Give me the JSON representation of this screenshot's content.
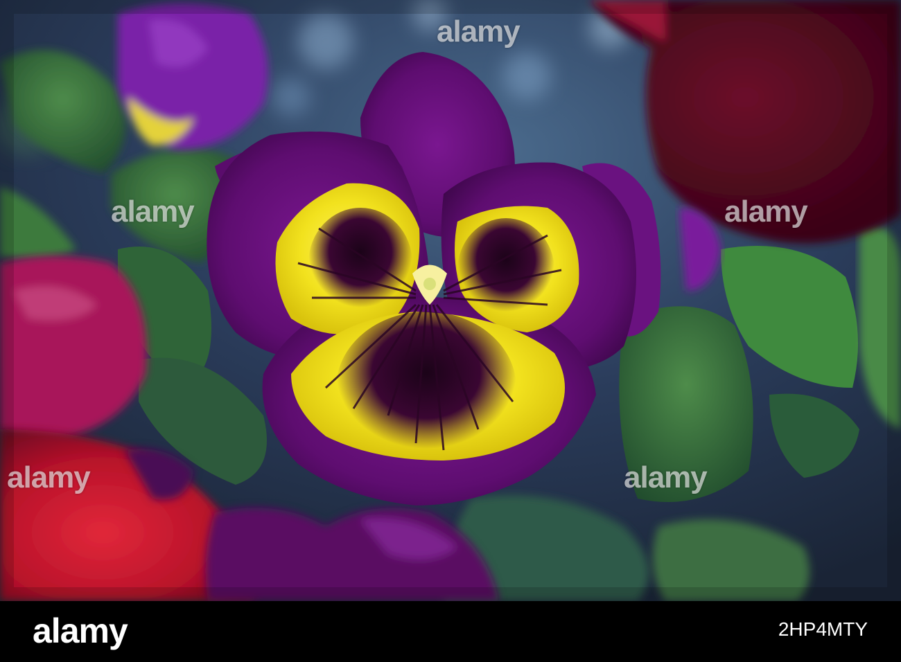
{
  "watermark": {
    "text": "alamy",
    "color": "rgba(255,255,255,0.62)"
  },
  "footer": {
    "logo": "alamy",
    "image_id": "2HP4MTY",
    "background": "#000000"
  },
  "colors": {
    "petal_purple": "#6a0f7e",
    "throat_yellow": "#f2e21e",
    "vein_dark": "#2a0524",
    "leaf_green": "#2c6a3a",
    "background_blue": "#2b3d5c",
    "red_pansy": "#c01a2e"
  }
}
